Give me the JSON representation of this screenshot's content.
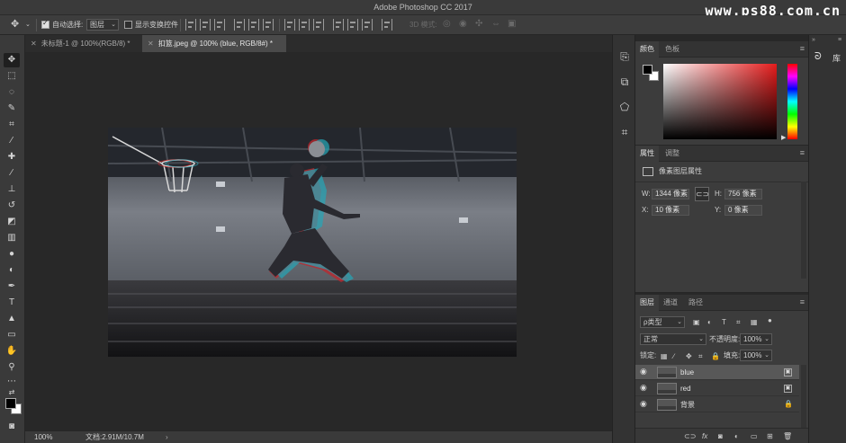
{
  "window": {
    "title": "Adobe Photoshop CC 2017",
    "watermark": "www.ps88.com.cn"
  },
  "options_bar": {
    "auto_select_label": "自动选择:",
    "auto_select_target": "图层",
    "show_transform_label": "显示变换控件",
    "mode_3d_label": "3D 模式:",
    "auto_select_checked": true,
    "show_transform_checked": false
  },
  "tabs": [
    {
      "label": "未标题-1 @ 100%(RGB/8) *",
      "active": false
    },
    {
      "label": "扣篮.jpeg @ 100% (blue, RGB/8#) *",
      "active": true
    }
  ],
  "status": {
    "zoom": "100%",
    "doc_info": "文档:2.91M/10.7M"
  },
  "color_panel": {
    "tabs": [
      "颜色",
      "色板"
    ],
    "hue_accent": "#e51c1c"
  },
  "properties_panel": {
    "tabs": [
      "属性",
      "调整"
    ],
    "header": "像素图层属性",
    "w_label": "W:",
    "w_value": "1344 像素",
    "h_label": "H:",
    "h_value": "756 像素",
    "x_label": "X:",
    "x_value": "10 像素",
    "y_label": "Y:",
    "y_value": "0 像素"
  },
  "layers_panel": {
    "tabs": [
      "图层",
      "通道",
      "路径"
    ],
    "filter_kind": "ρ类型",
    "blend_mode": "正常",
    "opacity_label": "不透明度:",
    "opacity_value": "100%",
    "lock_label": "锁定:",
    "fill_label": "填充:",
    "fill_value": "100%",
    "layers": [
      {
        "name": "blue",
        "selected": true
      },
      {
        "name": "red",
        "selected": false
      },
      {
        "name": "背景",
        "selected": false
      }
    ]
  },
  "libraries": {
    "label": "库"
  }
}
